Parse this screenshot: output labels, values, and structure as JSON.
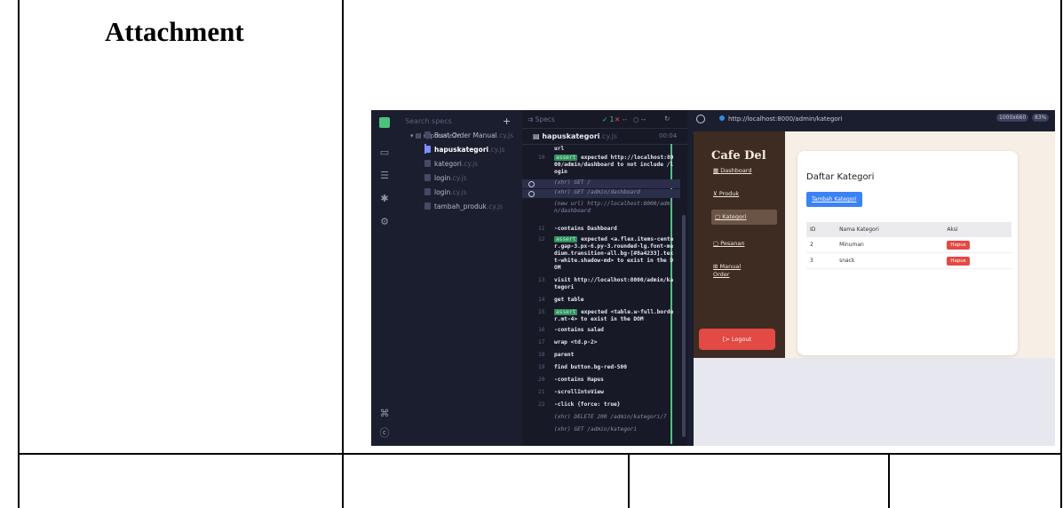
{
  "document": {
    "heading": "Attachment"
  },
  "cypress": {
    "search_placeholder": "Search specs",
    "add_icon": "plus-icon",
    "folder": "cypress\\e2e",
    "specs": [
      {
        "name": "Buat Order Manual",
        "ext": ".cy.js",
        "active": false
      },
      {
        "name": "hapuskategori",
        "ext": ".cy.js",
        "active": true
      },
      {
        "name": "kategori",
        "ext": ".cy.js",
        "active": false
      },
      {
        "name": "login",
        "ext": ".cy.js",
        "active": false
      },
      {
        "name": "login",
        "ext": ".cy.js",
        "active": false
      },
      {
        "name": "tambah_produk",
        "ext": ".cy.js",
        "active": false
      }
    ],
    "log_header": {
      "specs_label": "Specs",
      "passed": "✓ 1",
      "failed": "✕ --",
      "pending": "○ --",
      "reload_icon": "reload-icon"
    },
    "spec_title": "hapuskategori",
    "spec_ext": ".cy.js",
    "duration": "00:04",
    "commands": [
      {
        "num": "",
        "text": "url"
      },
      {
        "num": "10",
        "badge": "assert",
        "text": " expected http://localhost:8000/admin/dashboard to not include /login"
      },
      {
        "num": "",
        "text": "(xhr) GET /",
        "dim": true
      },
      {
        "num": "",
        "text": "(xhr) GET /admin/dashboard",
        "dim": true
      },
      {
        "num": "",
        "text": "(new url) http://localhost:8000/admin/dashboard",
        "dim": true
      },
      {
        "num": "11",
        "text": "-contains Dashboard"
      },
      {
        "num": "12",
        "badge": "assert",
        "text": " expected <a.flex.items-center.gap-3.px-6.py-3.rounded-lg.font-medium.transition-all.bg-[#8a4233].text-white.shadow-md> to exist in the DOM"
      },
      {
        "num": "13",
        "text": "visit http://localhost:8000/admin/kategori"
      },
      {
        "num": "14",
        "text": "get table"
      },
      {
        "num": "15",
        "badge": "assert",
        "text": " expected <table.w-full.border.mt-4> to exist in the DOM"
      },
      {
        "num": "16",
        "text": "-contains salad"
      },
      {
        "num": "17",
        "text": "wrap <td.p-2>"
      },
      {
        "num": "18",
        "text": "parent"
      },
      {
        "num": "19",
        "text": "find button.bg-red-500"
      },
      {
        "num": "20",
        "text": "-contains Hapus"
      },
      {
        "num": "21",
        "text": "-scrollIntoView"
      },
      {
        "num": "22",
        "text": "-click {force: true}"
      },
      {
        "num": "",
        "text": "(xhr) DELETE 200 /admin/kategori/7",
        "dim": true
      },
      {
        "num": "",
        "text": "(xhr) GET /admin/kategori",
        "dim": true
      }
    ],
    "url": "http://localhost:8000/admin/kategori",
    "viewport": "1000x660",
    "zoom": "83%"
  },
  "app": {
    "brand": "Cafe Del",
    "nav": [
      {
        "icon": "grid-icon",
        "label": "Dashboard"
      },
      {
        "icon": "cart-icon",
        "label": "Produk"
      },
      {
        "icon": "tag-icon",
        "label": "Kategori"
      },
      {
        "icon": "box-icon",
        "label": "Pesanan"
      },
      {
        "icon": "plus-square-icon",
        "label": "Manual Order"
      }
    ],
    "logout": "[> Logout",
    "page_title": "Daftar Kategori",
    "add_button": "Tambah Kategori",
    "table": {
      "columns": [
        "ID",
        "Nama Kategori",
        "Aksi"
      ],
      "rows": [
        {
          "id": "2",
          "name": "Minuman",
          "action": "Hapus"
        },
        {
          "id": "3",
          "name": "snack",
          "action": "Hapus"
        }
      ]
    }
  }
}
